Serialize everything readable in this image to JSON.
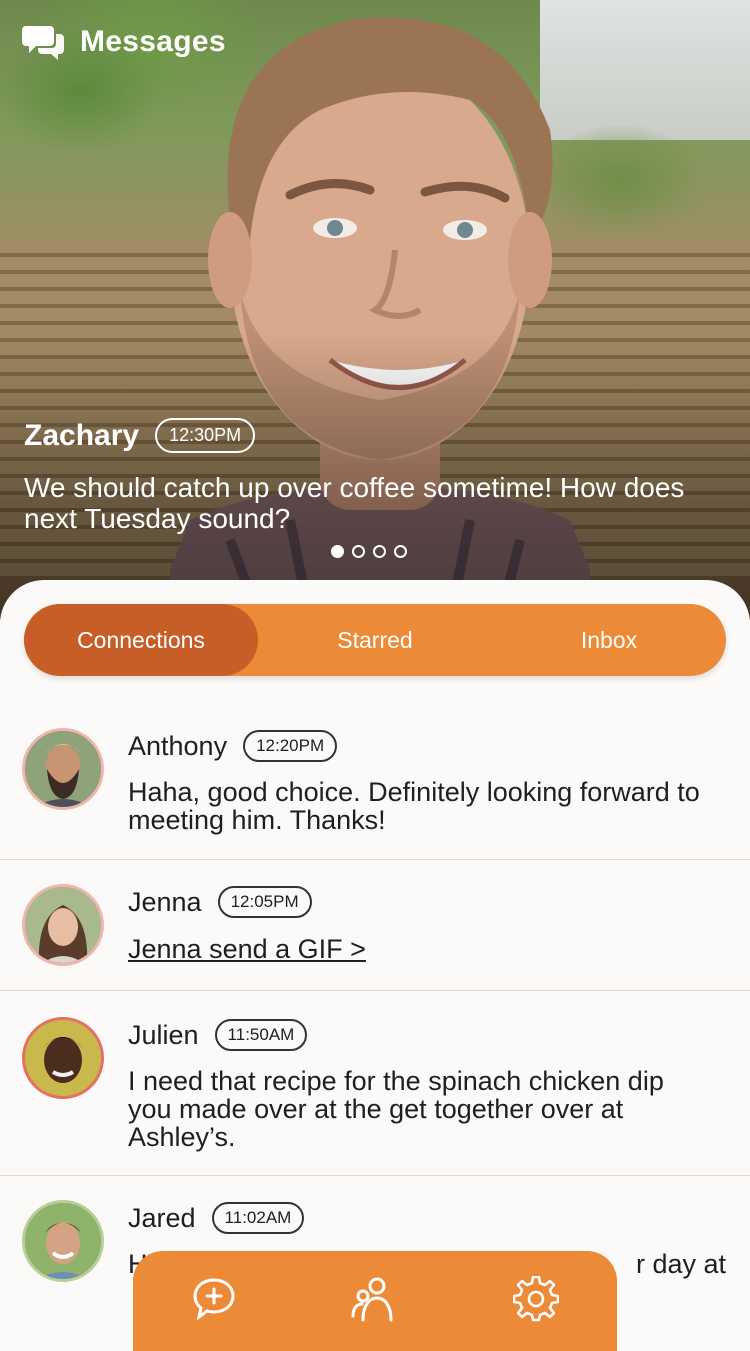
{
  "header": {
    "title": "Messages",
    "icon": "chat-bubbles-icon"
  },
  "featured": {
    "name": "Zachary",
    "time": "12:30PM",
    "message": "We should catch up over coffee sometime!  How does next Tuesday sound?",
    "carousel_total": 4,
    "carousel_active": 1
  },
  "tabs": [
    {
      "label": "Connections",
      "active": true
    },
    {
      "label": "Starred",
      "active": false
    },
    {
      "label": "Inbox",
      "active": false
    }
  ],
  "messages": [
    {
      "name": "Anthony",
      "time": "12:20PM",
      "text": "Haha, good choice. Definitely looking forward to meeting him. Thanks!",
      "type": "text"
    },
    {
      "name": "Jenna",
      "time": "12:05PM",
      "text": "Jenna send a GIF >",
      "type": "link"
    },
    {
      "name": "Julien",
      "time": "11:50AM",
      "text": "I need that recipe for the spinach chicken dip you made over at the get together over at Ashley’s.",
      "type": "text"
    },
    {
      "name": "Jared",
      "time": "11:02AM",
      "text_visible_start": "H",
      "text_visible_end": "r day at",
      "type": "text"
    }
  ],
  "bottom_nav": [
    {
      "icon": "new-message-icon"
    },
    {
      "icon": "contacts-icon"
    },
    {
      "icon": "settings-gear-icon"
    }
  ],
  "colors": {
    "accent": "#ec8a38",
    "accent_active": "#c85e27",
    "avatar_ring": "#f0b6ad"
  }
}
